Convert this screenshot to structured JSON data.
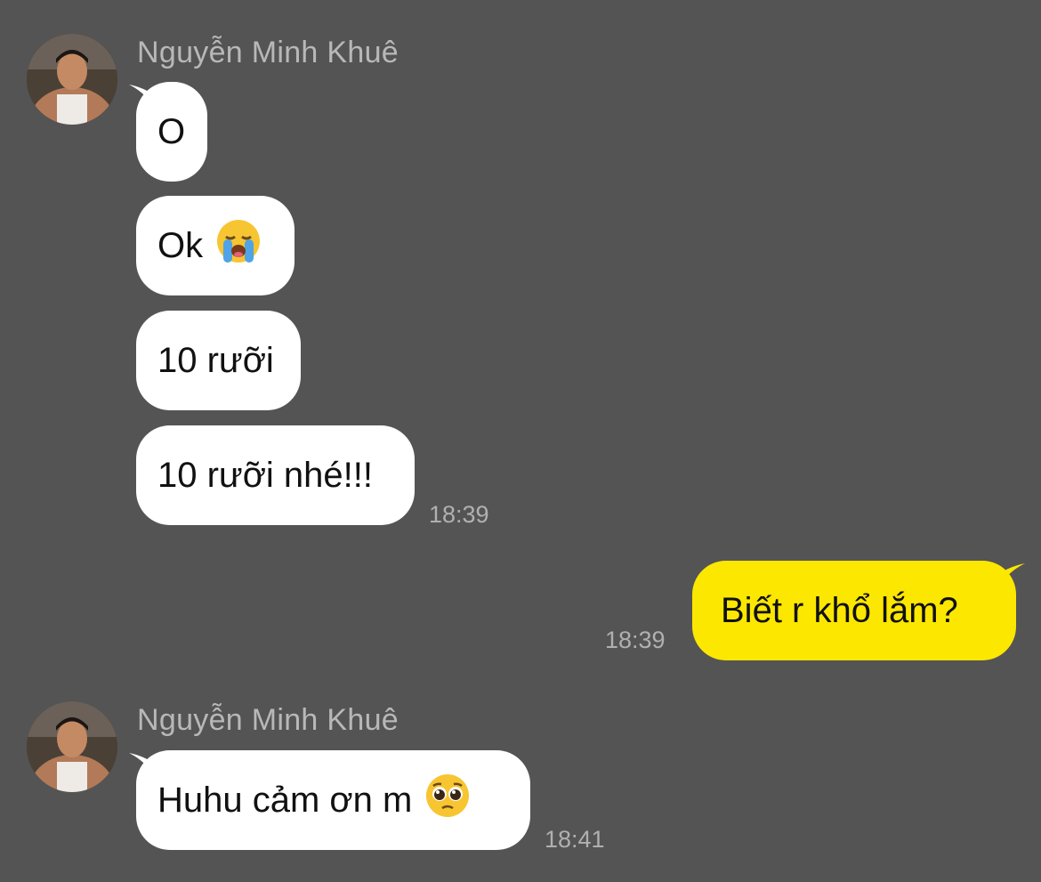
{
  "colors": {
    "background": "#545454",
    "incoming_bubble": "#ffffff",
    "outgoing_bubble": "#fce700",
    "meta_text": "#b0b0b0"
  },
  "groups": [
    {
      "sender": "Nguyễn Minh Khuê",
      "messages": [
        {
          "text": "O"
        },
        {
          "text": "Ok",
          "emoji": "loudly-crying-face-icon"
        },
        {
          "text": "10 rưỡi"
        },
        {
          "text": "10 rưỡi nhé!!!"
        }
      ],
      "time": "18:39"
    },
    {
      "sender": "me",
      "messages": [
        {
          "text": "Biết r khổ lắm?"
        }
      ],
      "time": "18:39"
    },
    {
      "sender": "Nguyễn Minh Khuê",
      "messages": [
        {
          "text": "Huhu cảm ơn m",
          "emoji": "pleading-face-icon"
        }
      ],
      "time": "18:41"
    }
  ]
}
